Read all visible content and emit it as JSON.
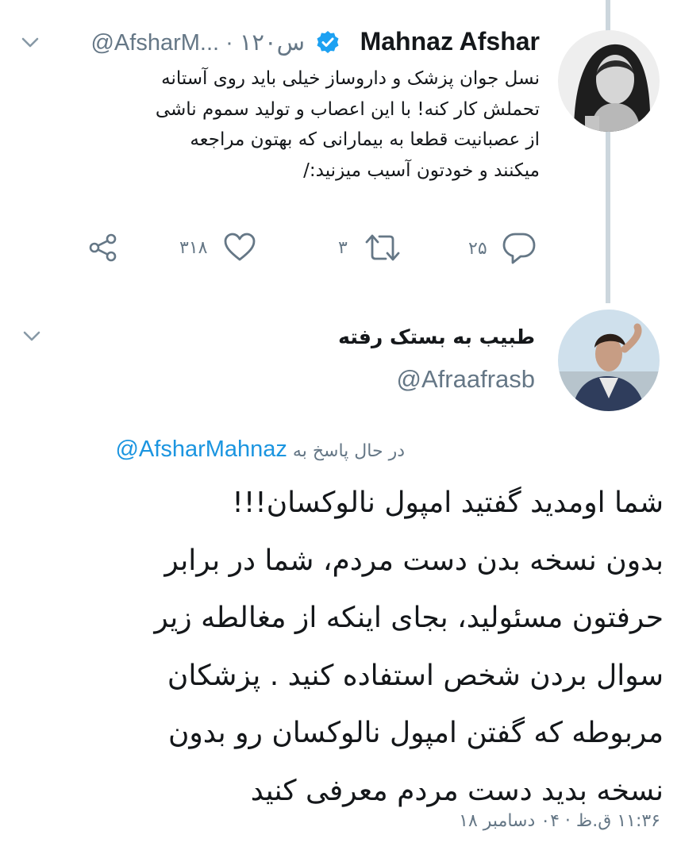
{
  "parent_tweet": {
    "author_name": "Mahnaz Afshar",
    "verified": true,
    "handle_truncated": "@AfsharM...",
    "time_ago": "۱۲۰س",
    "text_lines": [
      "نسل جوان پزشک و داروساز خیلی باید روی آستانه",
      "تحملش کار کنه! با این اعصاب و تولید سموم ناشی",
      "از عصبانیت قطعا به بیمارانی که بهتون مراجعه",
      "میکنند و خودتون آسیب میزنید:/"
    ],
    "replies_count": "۲۵",
    "retweets_count": "۳",
    "likes_count": "۳۱۸"
  },
  "reply_tweet": {
    "author_name": "طبیب به بستک رفته",
    "handle": "@Afraafrasb",
    "replying_to_label": "در حال پاسخ به",
    "replying_to_handle": "@AfsharMahnaz",
    "text_lines": [
      "شما اومدید گفتید امپول نالوکسان!!!",
      "بدون نسخه بدن دست مردم، شما در برابر",
      "حرفتون مسئولید، بجای اینکه از مغالطه زیر",
      "سوال بردن شخص استفاده کنید . پزشکان",
      "مربوطه که گفتن امپول نالوکسان رو بدون",
      "نسخه بدید دست مردم معرفی کنید"
    ],
    "timestamp": "۱۱:۳۶ ق.ظ · ۰۴ دسامبر ۱۸"
  },
  "icons": {
    "caret": "chevron-down-icon",
    "verified": "verified-badge-icon",
    "reply": "reply-icon",
    "retweet": "retweet-icon",
    "like": "heart-icon",
    "share": "share-icon"
  },
  "colors": {
    "text_primary": "#14171a",
    "text_secondary": "#657786",
    "link": "#1b95e0",
    "verified": "#1da1f2",
    "thread_line": "#ccd6dd"
  }
}
